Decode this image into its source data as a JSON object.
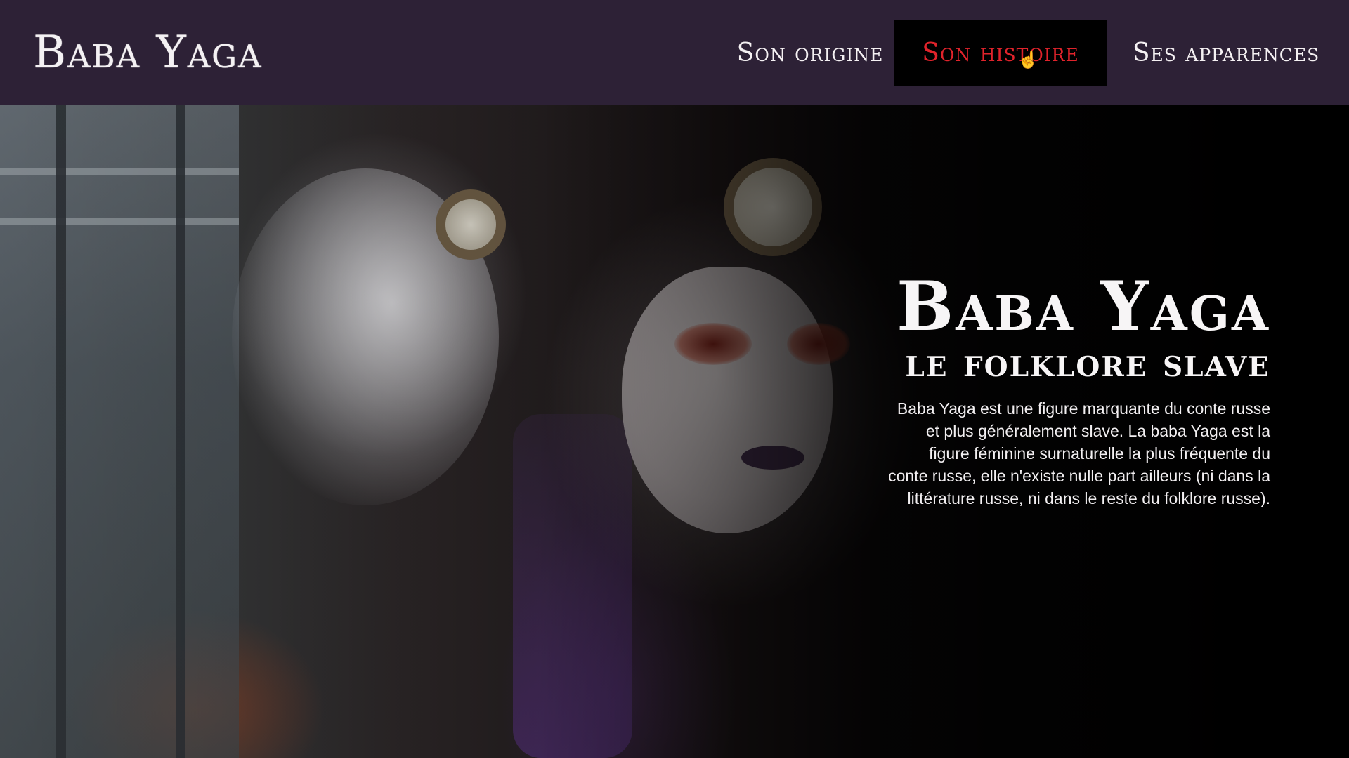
{
  "header": {
    "logo": "Baba Yaga",
    "nav": [
      {
        "label": "Son origine",
        "active": false
      },
      {
        "label": "Son histoire",
        "active": true
      },
      {
        "label": "Ses apparences",
        "active": false
      }
    ]
  },
  "hero": {
    "title": "Baba Yaga",
    "subtitle": "le folklore slave",
    "body": "Baba Yaga est une figure marquante du conte russe et plus généralement slave. La baba Yaga est la figure féminine surnaturelle la plus fréquente du conte russe, elle n'existe nulle part ailleurs (ni dans la littérature russe, ni dans le reste du folklore russe)."
  },
  "colors": {
    "header_bg": "#2d2136",
    "active_nav_bg": "#000000",
    "active_nav_text": "#e0232b",
    "text": "#f7f5f6"
  },
  "icons": {
    "cursor": "hand-pointer-icon"
  }
}
